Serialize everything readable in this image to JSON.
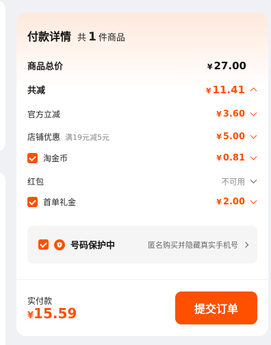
{
  "header": {
    "title": "付款详情",
    "count_prefix": "共",
    "count": "1",
    "count_suffix": "件商品"
  },
  "rows": {
    "total": {
      "label": "商品总价",
      "currency": "¥",
      "value": "27.00"
    },
    "discount_total": {
      "label": "共减",
      "currency": "¥",
      "value": "11.41"
    },
    "official": {
      "label": "官方立减",
      "currency": "¥",
      "value": "3.60"
    },
    "shop": {
      "label": "店铺优惠",
      "sub": "满19元减5元",
      "currency": "¥",
      "value": "5.00"
    },
    "coins": {
      "label": "淘金币",
      "checked": true,
      "currency": "¥",
      "value": "0.81"
    },
    "redpacket": {
      "label": "红包",
      "status": "不可用"
    },
    "first_order": {
      "label": "首单礼金",
      "checked": true,
      "currency": "¥",
      "value": "2.00"
    }
  },
  "protect": {
    "title": "号码保护中",
    "desc": "匿名购买并隐藏真实手机号",
    "checked": true
  },
  "footer": {
    "paid_label": "实付款",
    "currency": "¥",
    "paid_value": "15.59",
    "submit_label": "提交订单"
  },
  "colors": {
    "accent": "#ff5000",
    "background": "#f0f1f5",
    "protect_bg": "#f5f5f5"
  },
  "icons": [
    "checkbox-checked-icon",
    "chevron-down-icon",
    "chevron-up-icon",
    "chevron-right-icon",
    "shield-icon"
  ]
}
